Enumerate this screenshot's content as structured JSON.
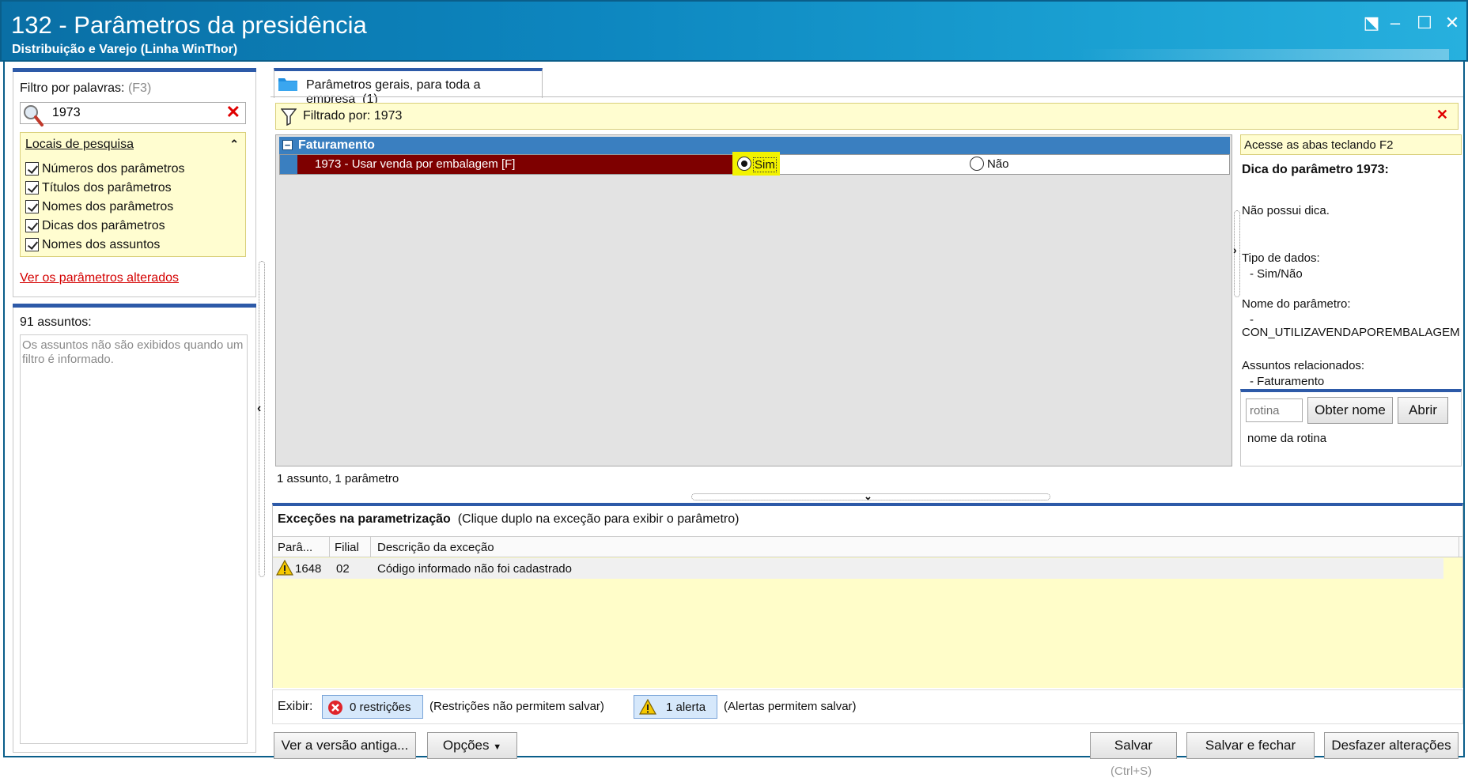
{
  "window": {
    "title": "132 - Parâmetros da presidência",
    "subtitle": "Distribuição e Varejo (Linha WinThor)",
    "buttons": [
      "⬔",
      "–",
      "☐",
      "✕"
    ]
  },
  "filter": {
    "label": "Filtro por palavras:",
    "shortcut": "(F3)",
    "value": "1973",
    "locations_title": "Locais de pesquisa",
    "locations": [
      "Números dos parâmetros",
      "Títulos dos parâmetros",
      "Nomes dos parâmetros",
      "Dicas dos parâmetros",
      "Nomes dos assuntos"
    ],
    "changed_link": "Ver os parâmetros alterados"
  },
  "subjects": {
    "count_label": "91 assuntos:",
    "note": "Os assuntos não são exibidos quando um filtro é informado."
  },
  "tab": {
    "label": "Parâmetros gerais, para toda a empresa",
    "count": "(1)"
  },
  "filtered_bar": {
    "label": "Filtrado por: 1973"
  },
  "group": {
    "toggle": "−",
    "name": "Faturamento",
    "row": {
      "label": "1973 - Usar venda por embalagem [F]",
      "option_yes": "Sim",
      "option_no": "Não",
      "selected": "Sim"
    }
  },
  "status_text": "1 assunto, 1 parâmetro",
  "hint_panel": {
    "tab_hint": "Acesse as abas teclando F2",
    "title": "Dica do parâmetro 1973:",
    "no_hint": "Não possui dica.",
    "data_type_label": "Tipo de dados:",
    "data_type_value": "- Sim/Não",
    "param_name_label": "Nome do parâmetro:",
    "param_name_dash": "-",
    "param_name_value": "CON_UTILIZAVENDAPOREMBALAGEM",
    "related_label": "Assuntos relacionados:",
    "related_value": "- Faturamento",
    "routine_placeholder": "rotina",
    "get_name_button": "Obter nome",
    "open_button": "Abrir",
    "routine_name_label": "nome da rotina"
  },
  "exceptions": {
    "title": "Exceções na parametrização",
    "subtitle": "(Clique duplo na exceção para exibir o parâmetro)",
    "columns": [
      "Parâ...",
      "Filial",
      "Descrição da exceção"
    ],
    "rows": [
      {
        "param": "1648",
        "branch": "02",
        "description": "Código informado não foi cadastrado"
      }
    ],
    "show_label": "Exibir:",
    "restrictions_button": "0 restrições",
    "restrictions_note": "(Restrições não permitem salvar)",
    "alerts_button": "1 alerta",
    "alerts_note": "(Alertas permitem salvar)"
  },
  "footer": {
    "old_version_button": "Ver a versão antiga...",
    "options_button": "Opções",
    "save_button": "Salvar",
    "save_shortcut": "(Ctrl+S)",
    "save_close_button": "Salvar e fechar",
    "undo_button": "Desfazer alterações"
  },
  "colors": {
    "titlebar": "#0d86bf",
    "group_header": "#3a7fc0",
    "selected_row": "#7e0000",
    "highlight": "#f2f200",
    "panel_yellow": "#fffdd0",
    "accent_blue": "#2d5aa8"
  }
}
